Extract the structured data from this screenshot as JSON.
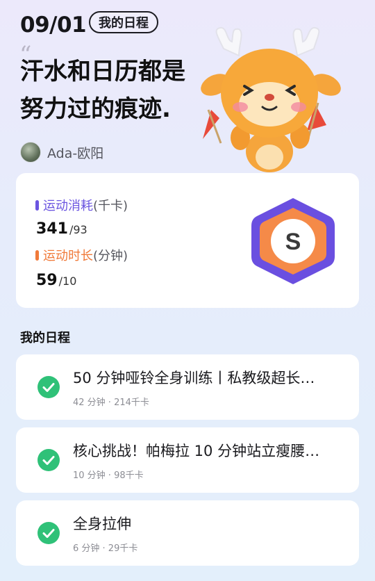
{
  "header": {
    "date": "09/01",
    "tag": "我的日程",
    "slogan_line1": "汗水和日历都是",
    "slogan_line2": "努力过的痕迹.",
    "author": "Ada-欧阳"
  },
  "stats": {
    "calories": {
      "label": "运动消耗",
      "unit": "(千卡)",
      "value": "341",
      "target": "/93",
      "color": "#6b55e0"
    },
    "duration": {
      "label": "运动时长",
      "unit": "(分钟)",
      "value": "59",
      "target": "/10",
      "color": "#f07a3a"
    },
    "badge_letter": "S"
  },
  "schedule": {
    "title": "我的日程",
    "items": [
      {
        "title": "50 分钟哑铃全身训练丨私教级超长…",
        "meta": "42 分钟 · 214千卡"
      },
      {
        "title": "核心挑战！帕梅拉 10 分钟站立瘦腰…",
        "meta": "10 分钟 · 98千卡"
      },
      {
        "title": "全身拉伸",
        "meta": "6 分钟 · 29千卡"
      }
    ]
  },
  "colors": {
    "check_green": "#2fc178",
    "badge_purple": "#6a4fe0",
    "badge_orange": "#f58a48"
  }
}
